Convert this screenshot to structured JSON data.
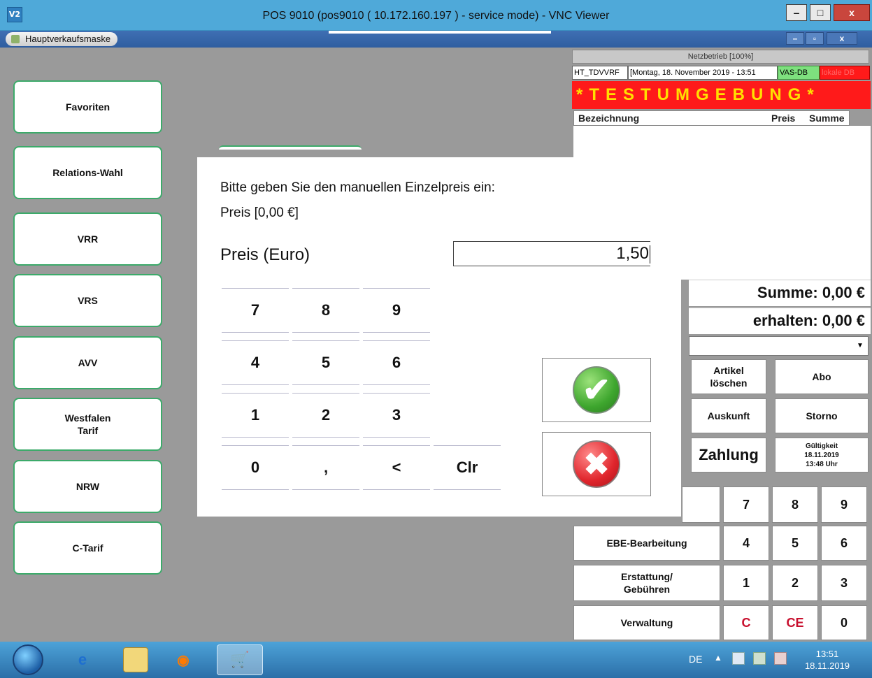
{
  "window": {
    "title": "POS 9010 (pos9010 ( 10.172.160.197 ) - service mode) - VNC Viewer",
    "logo": "V2",
    "minimize": "‒",
    "maximize": "□",
    "close": "x"
  },
  "app_tab": {
    "label": "Hauptverkaufsmaske"
  },
  "sidebar": {
    "items": [
      {
        "label": "Favoriten"
      },
      {
        "label": "Relations-Wahl"
      },
      {
        "label": "VRR"
      },
      {
        "label": "VRS"
      },
      {
        "label": "AVV"
      },
      {
        "label": "Westfalen\nTarif"
      },
      {
        "label": "NRW"
      },
      {
        "label": "C-Tarif"
      }
    ]
  },
  "status": {
    "network": "Netzbetrieb [100%]",
    "terminal": "HT_TDVVRF",
    "datetime": "[Montag, 18. November 2019 - 13:51",
    "db": "VAS-DB",
    "local_db": "lokale DB",
    "test_banner": "*TESTUMGEBUNG*"
  },
  "list": {
    "col_name": "Bezeichnung",
    "col_price": "Preis",
    "col_sum": "Summe"
  },
  "totals": {
    "summe": "Summe: 0,00 €",
    "erhalten": "erhalten: 0,00 €"
  },
  "pos_buttons": {
    "artikel": "Artikel\nlöschen",
    "abo": "Abo",
    "auskunft": "Auskunft",
    "storno": "Storno",
    "zahlung": "Zahlung",
    "gueltigkeit": "Gültigkeit\n18.11.2019\n13:48 Uhr",
    "ebe": "EBE-Bearbeitung",
    "erstattung": "Erstattung/\nGebühren",
    "verwaltung": "Verwaltung",
    "n7": "7",
    "n8": "8",
    "n9": "9",
    "n4": "4",
    "n5": "5",
    "n6": "6",
    "n1": "1",
    "n2": "2",
    "n3": "3",
    "c": "C",
    "ce": "CE",
    "n0": "0"
  },
  "dialog": {
    "prompt": "Bitte geben Sie den manuellen Einzelpreis ein:",
    "range": "Preis [0,00 €]",
    "field_label": "Preis (Euro)",
    "value": "1,50",
    "keys": [
      "7",
      "8",
      "9",
      "4",
      "5",
      "6",
      "1",
      "2",
      "3",
      "0",
      ",",
      "<",
      "Clr"
    ],
    "ok_icon": "check-icon",
    "cancel_icon": "x-icon"
  },
  "taskbar": {
    "lang": "DE",
    "time": "13:51",
    "date": "18.11.2019"
  }
}
